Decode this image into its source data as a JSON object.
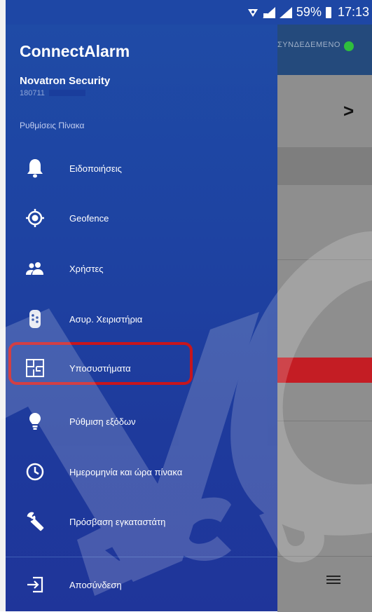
{
  "status_bar": {
    "battery": "59%",
    "time": "17:13"
  },
  "app": {
    "connection_status": "ΣΥΝΔΕΔΕΜΕΝΟ",
    "connection_color": "#2fbf3d",
    "chevron": ">"
  },
  "drawer": {
    "title": "ConnectAlarm",
    "company": "Novatron Security",
    "serial": "180711",
    "section": "Ρυθμίσεις Πίνακα",
    "items": [
      {
        "label": "Ειδοποιήσεις",
        "icon": "bell-icon"
      },
      {
        "label": "Geofence",
        "icon": "target-icon"
      },
      {
        "label": "Χρήστες",
        "icon": "users-icon"
      },
      {
        "label": "Ασυρ. Χειριστήρια",
        "icon": "remote-control-icon"
      },
      {
        "label": "Υποσυστήματα",
        "icon": "floorplan-icon"
      },
      {
        "label": "Ρύθμιση εξόδων",
        "icon": "lightbulb-icon"
      },
      {
        "label": "Ημερομηνία και ώρα πίνακα",
        "icon": "clock-icon"
      },
      {
        "label": "Πρόσβαση εγκαταστάτη",
        "icon": "wrench-icon"
      }
    ],
    "logout": {
      "label": "Αποσύνδεση",
      "icon": "logout-icon"
    }
  },
  "colors": {
    "drawer_top": "#1f4ba6",
    "drawer_bottom": "#1f359a",
    "highlight": "#c8151c"
  }
}
